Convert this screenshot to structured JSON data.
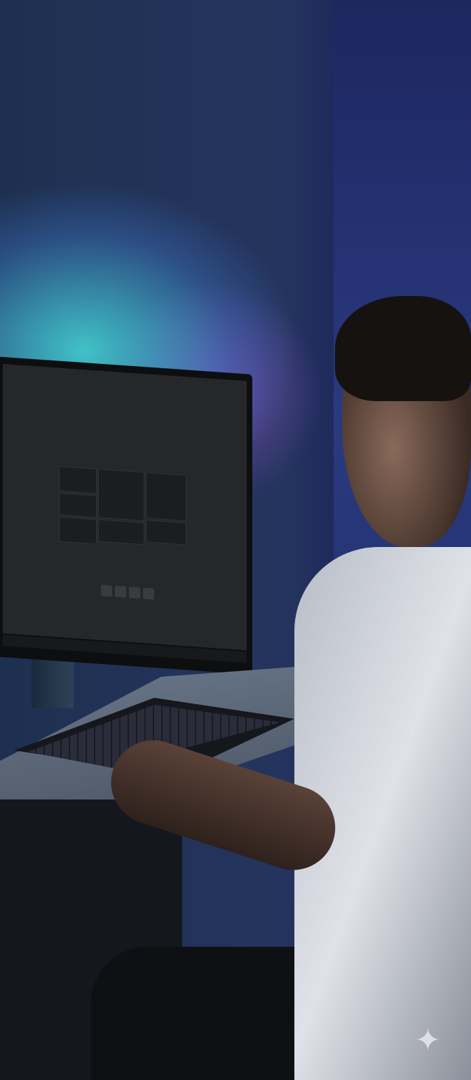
{
  "scene": {
    "description_colors": {
      "wall_glow": "#46dcdc",
      "wall": "#25345e",
      "screen": "#262728"
    },
    "sparkle_icon": "sparkle-icon"
  }
}
